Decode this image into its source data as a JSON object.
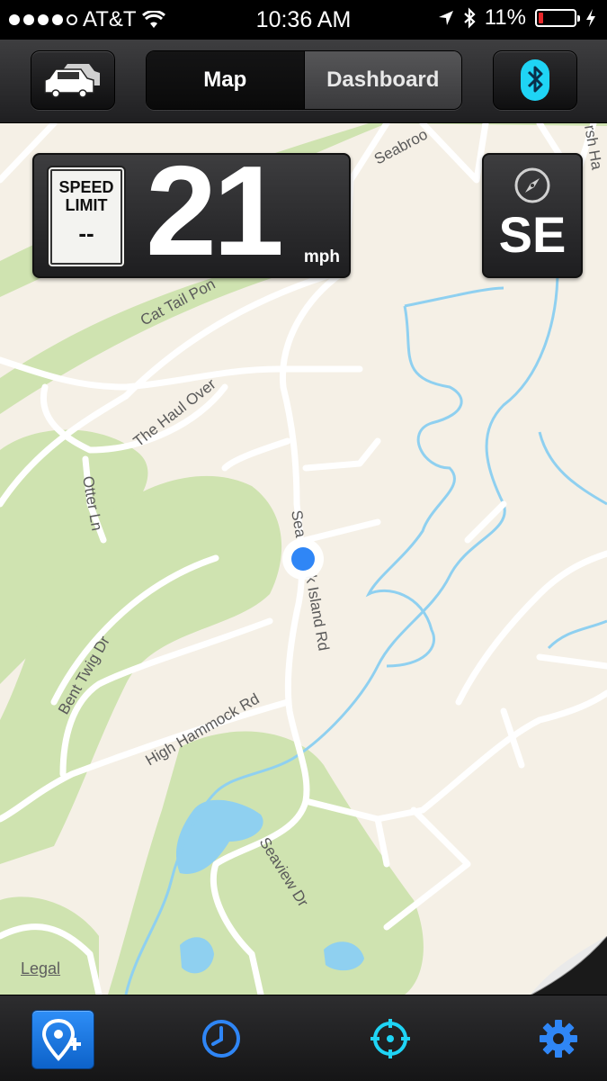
{
  "status_bar": {
    "carrier": "AT&T",
    "time": "10:36 AM",
    "battery": "11%",
    "battery_level": 0.11
  },
  "toolbar": {
    "car_icon": "cars-icon",
    "segments": [
      {
        "label": "Map",
        "active": true
      },
      {
        "label": "Dashboard",
        "active": false
      }
    ],
    "bluetooth_icon": "bluetooth-icon"
  },
  "speed_limit": {
    "line1": "SPEED",
    "line2": "LIMIT",
    "value": "--"
  },
  "speed": {
    "value": "21",
    "unit": "mph"
  },
  "heading": {
    "icon": "compass-icon",
    "direction": "SE"
  },
  "map": {
    "street_labels": [
      "Seabroo",
      "Cat Tail Pon",
      "The Haul Over",
      "Otter Ln",
      "Sea",
      "k Island Rd",
      "Bent Twig Dr",
      "High Hammock Rd",
      "Seaview Dr",
      "rsh Ha"
    ],
    "legal": "Legal"
  },
  "tabbar": {
    "items": [
      {
        "name": "add-location",
        "icon": "pin-plus-icon"
      },
      {
        "name": "history",
        "icon": "clock-icon"
      },
      {
        "name": "locate",
        "icon": "crosshair-icon"
      },
      {
        "name": "settings",
        "icon": "gear-icon"
      }
    ]
  },
  "colors": {
    "accent_blue": "#2f86f6",
    "bluetooth_cyan": "#1fd4f5",
    "map_land": "#f5f0e6",
    "map_green": "#cfe3b0",
    "map_water": "#8fd0f0",
    "battery_low": "#e8282a"
  }
}
